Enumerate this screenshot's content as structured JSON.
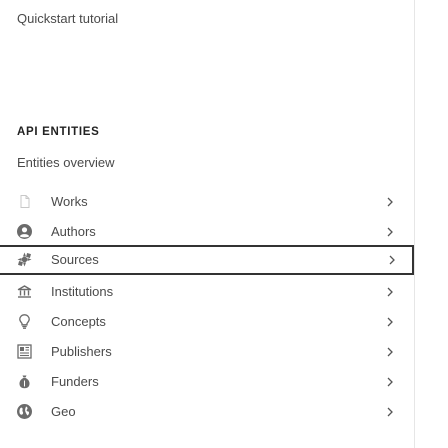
{
  "nav": {
    "quickstart_label": "Quickstart tutorial",
    "entities_overview_label": "Entities overview"
  },
  "section": {
    "heading": "API ENTITIES"
  },
  "entities": [
    {
      "label": "Works",
      "icon": "document-icon",
      "selected": false
    },
    {
      "label": "Authors",
      "icon": "person-icon",
      "selected": false
    },
    {
      "label": "Sources",
      "icon": "sources-icon",
      "selected": true
    },
    {
      "label": "Institutions",
      "icon": "institution-icon",
      "selected": false
    },
    {
      "label": "Concepts",
      "icon": "lightbulb-icon",
      "selected": false
    },
    {
      "label": "Publishers",
      "icon": "publisher-icon",
      "selected": false
    },
    {
      "label": "Funders",
      "icon": "funder-icon",
      "selected": false
    },
    {
      "label": "Geo",
      "icon": "globe-icon",
      "selected": false
    }
  ],
  "colors": {
    "text": "#4a4a4a",
    "icon": "#6b6b6b",
    "selected_border": "#333333",
    "divider": "#e6e6e6"
  }
}
